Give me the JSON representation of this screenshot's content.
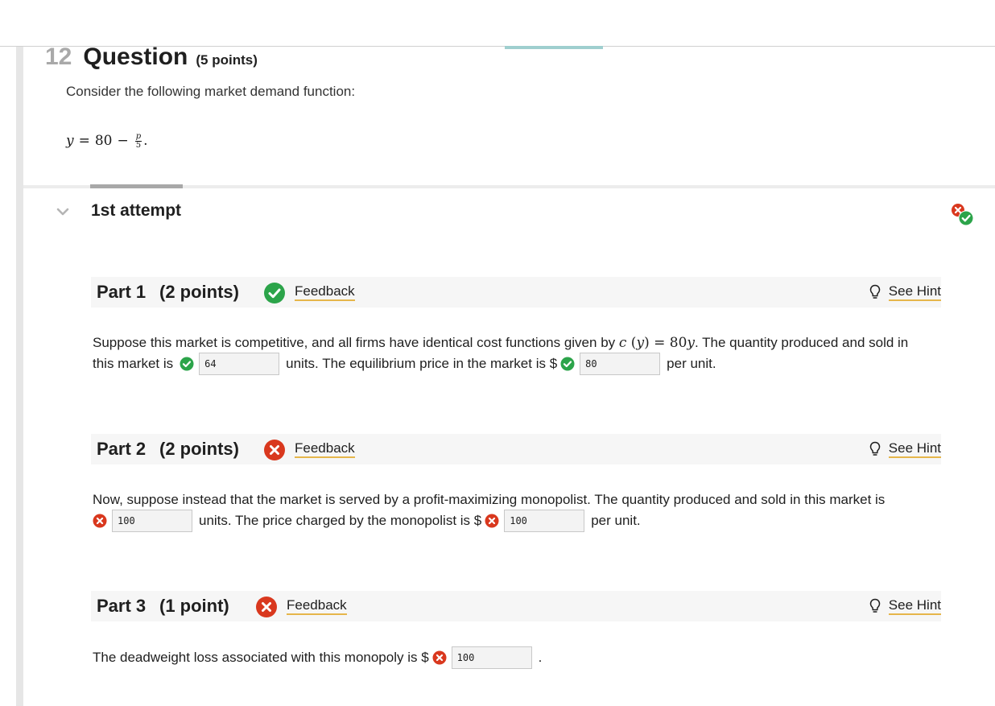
{
  "question": {
    "number": "12",
    "title": "Question",
    "points": "(5 points)",
    "prompt": "Consider the following market demand function:",
    "formula": {
      "lhs": "y",
      "eq": "=",
      "constant": "80",
      "minus": "−",
      "numerator": "p",
      "denominator": "5",
      "tail": "."
    }
  },
  "attempt": {
    "title": "1st attempt"
  },
  "parts": [
    {
      "title": "Part 1",
      "points": "(2 points)",
      "status": "correct",
      "feedback_label": "Feedback",
      "hint_label": "See Hint",
      "text_1": "Suppose this market is competitive, and all firms have identical cost functions given by ",
      "math_func": "c",
      "math_open": " (",
      "math_var": "y",
      "math_close": ") = 80",
      "math_var2": "y",
      "text_2": ". The quantity produced and sold in",
      "text_3": "this market is",
      "answer_1": "64",
      "text_4": "units. The equilibrium price in the market is $",
      "answer_2": "80",
      "text_5": "per unit."
    },
    {
      "title": "Part 2",
      "points": "(2 points)",
      "status": "incorrect",
      "feedback_label": "Feedback",
      "hint_label": "See Hint",
      "text_1": "Now, suppose instead that the market is served by a profit-maximizing monopolist. The quantity produced and sold in this market is",
      "answer_1": "100",
      "text_2": "units. The price charged by the monopolist is $",
      "answer_2": "100",
      "text_3": "per unit."
    },
    {
      "title": "Part 3",
      "points": "(1 point)",
      "status": "incorrect",
      "feedback_label": "Feedback",
      "hint_label": "See Hint",
      "text_1": "The deadweight loss associated with this monopoly is $",
      "answer_1": "100",
      "text_2": "."
    }
  ],
  "colors": {
    "correct": "#2ca44a",
    "incorrect": "#d9381e",
    "link_underline": "#e6b64b",
    "accent_teal": "#9fcfcf"
  }
}
